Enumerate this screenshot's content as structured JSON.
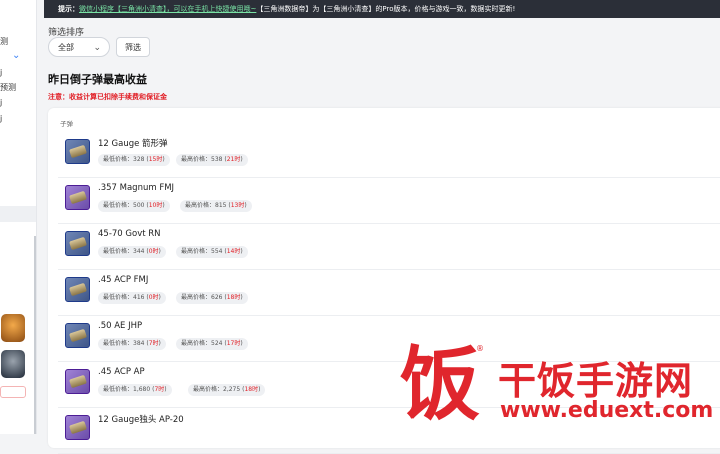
{
  "notice": {
    "tip_label": "提示：",
    "link_text": "微信小程序【三角洲小清查】，可以在手机上快捷使用哦~",
    "message": "【三角洲数据帝】为【三角洲小清查】的Pro版本，价格与游戏一致，数据实时更新!"
  },
  "sidebar": {
    "fragments": [
      "测",
      "j",
      "预测",
      "j",
      "j"
    ]
  },
  "filter": {
    "label": "筛选排序",
    "selected": "全部",
    "button": "筛选"
  },
  "page": {
    "title": "昨日倒子弹最高收益",
    "warning": "注意：收益计算已扣除手续费和保证金"
  },
  "table": {
    "column_header": "子弹",
    "rows": [
      {
        "name": "12 Gauge 箭形弹",
        "low_label": "最低价格：",
        "low_price": "328",
        "low_hour": "15时",
        "high_label": "最高价格：",
        "high_price": "538",
        "high_hour": "21时",
        "icon_color": "blue"
      },
      {
        "name": ".357 Magnum FMJ",
        "low_label": "最低价格：",
        "low_price": "500",
        "low_hour": "10时",
        "high_label": "最高价格：",
        "high_price": "815",
        "high_hour": "13时",
        "icon_color": "purple"
      },
      {
        "name": "45-70 Govt RN",
        "low_label": "最低价格：",
        "low_price": "344",
        "low_hour": "0时",
        "high_label": "最高价格：",
        "high_price": "554",
        "high_hour": "14时",
        "icon_color": "blue"
      },
      {
        "name": ".45 ACP FMJ",
        "low_label": "最低价格：",
        "low_price": "416",
        "low_hour": "0时",
        "high_label": "最高价格：",
        "high_price": "626",
        "high_hour": "18时",
        "icon_color": "blue"
      },
      {
        "name": ".50 AE JHP",
        "low_label": "最低价格：",
        "low_price": "384",
        "low_hour": "7时",
        "high_label": "最高价格：",
        "high_price": "524",
        "high_hour": "17时",
        "icon_color": "blue"
      },
      {
        "name": ".45 ACP AP",
        "low_label": "最低价格：",
        "low_price": "1,680",
        "low_hour": "7时",
        "high_label": "最高价格：",
        "high_price": "2,275",
        "high_hour": "18时",
        "icon_color": "purple"
      },
      {
        "name": "12 Gauge独头 AP-20",
        "low_label": "",
        "low_price": "",
        "low_hour": "",
        "high_label": "",
        "high_price": "",
        "high_hour": "",
        "icon_color": "purple"
      }
    ]
  },
  "watermark": {
    "logo_char": "饭",
    "reg": "®",
    "name": "干饭手游网",
    "url": "www.eduext.com"
  },
  "colors": {
    "accent_red": "#e11d24",
    "notice_bg": "#2b2f38",
    "link_green": "#79e3a5",
    "icon_blue": "#5a72a8",
    "icon_purple": "#8566c4"
  }
}
